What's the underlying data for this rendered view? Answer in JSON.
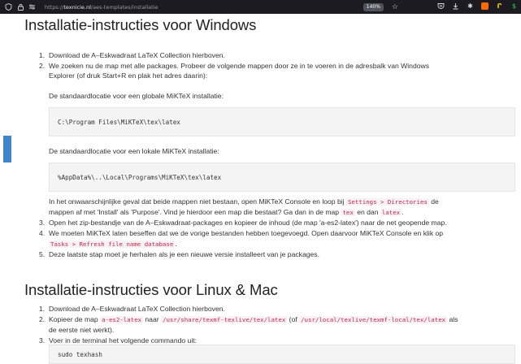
{
  "browser": {
    "url_prefix": "https://",
    "url_host": "texnicie.nl",
    "url_path": "/aes-templates/installatie",
    "zoom": "140%"
  },
  "windows": {
    "title": "Installatie-instructies voor Windows",
    "step1": "Download de A–Eskwadraat LaTeX Collection hierboven.",
    "step2_line1": "We zoeken nu de map met alle packages. Probeer de volgende mappen door ze in te voeren in de adresbalk van Windows",
    "step2_line2": "Explorer (of druk Start+R en plak het adres daarin):",
    "global_label": "De standaardlocatie voor een globale MiKTeX installatie:",
    "global_path": "C:\\Program Files\\MiKTeX\\tex\\latex",
    "local_label": "De standaardlocatie voor een lokale MiKTeX installatie:",
    "local_path": "%AppData%\\..\\Local\\Programs\\MiKTeX\\tex\\latex",
    "fallback_a": "In het onwaarschijnlijke geval dat beide mappen niet bestaan, open MiKTeX Console en loop bij ",
    "fallback_code1": "Settings > Directories",
    "fallback_b": " de",
    "fallback_c": "mappen af met 'Install' als 'Purpose'. Vind je hierdoor een map die bestaat? Ga dan in de map ",
    "fallback_code2": "tex",
    "fallback_d": " en dan ",
    "fallback_code3": "latex",
    "fallback_e": ".",
    "step3": "Open het zip-bestandje van de A–Eskwadraat-packages en kopieer de inhoud (de map 'a-es2-latex') naar de net geopende map.",
    "step4_line1": "We moeten MiKTeX laten beseffen dat we de vorige bestanden hebben toegevoegd. Open daarvoor MiKTeX Console en klik op",
    "step4_code": "Tasks > Refresh file name database",
    "step4_end": ".",
    "step5": "Deze laatste stap moet je herhalen als je een nieuwe versie installeert van je packages."
  },
  "linux": {
    "title": "Installatie-instructies voor Linux & Mac",
    "step1": "Download de A–Eskwadraat LaTeX Collection hierboven.",
    "step2_a": "Kopieer de map ",
    "step2_code1": "a-es2-latex",
    "step2_b": " naar ",
    "step2_code2": "/usr/share/texmf-texlive/tex/latex",
    "step2_c": " (of ",
    "step2_code3": "/usr/local/texlive/texmf-local/tex/latex",
    "step2_d": " als",
    "step2_line2": "de eerste niet werkt).",
    "step3": "Voer in de terminal het volgende commando uit:",
    "command": "sudo texhash"
  },
  "numbers": [
    "1.",
    "2.",
    "3.",
    "4.",
    "5."
  ]
}
